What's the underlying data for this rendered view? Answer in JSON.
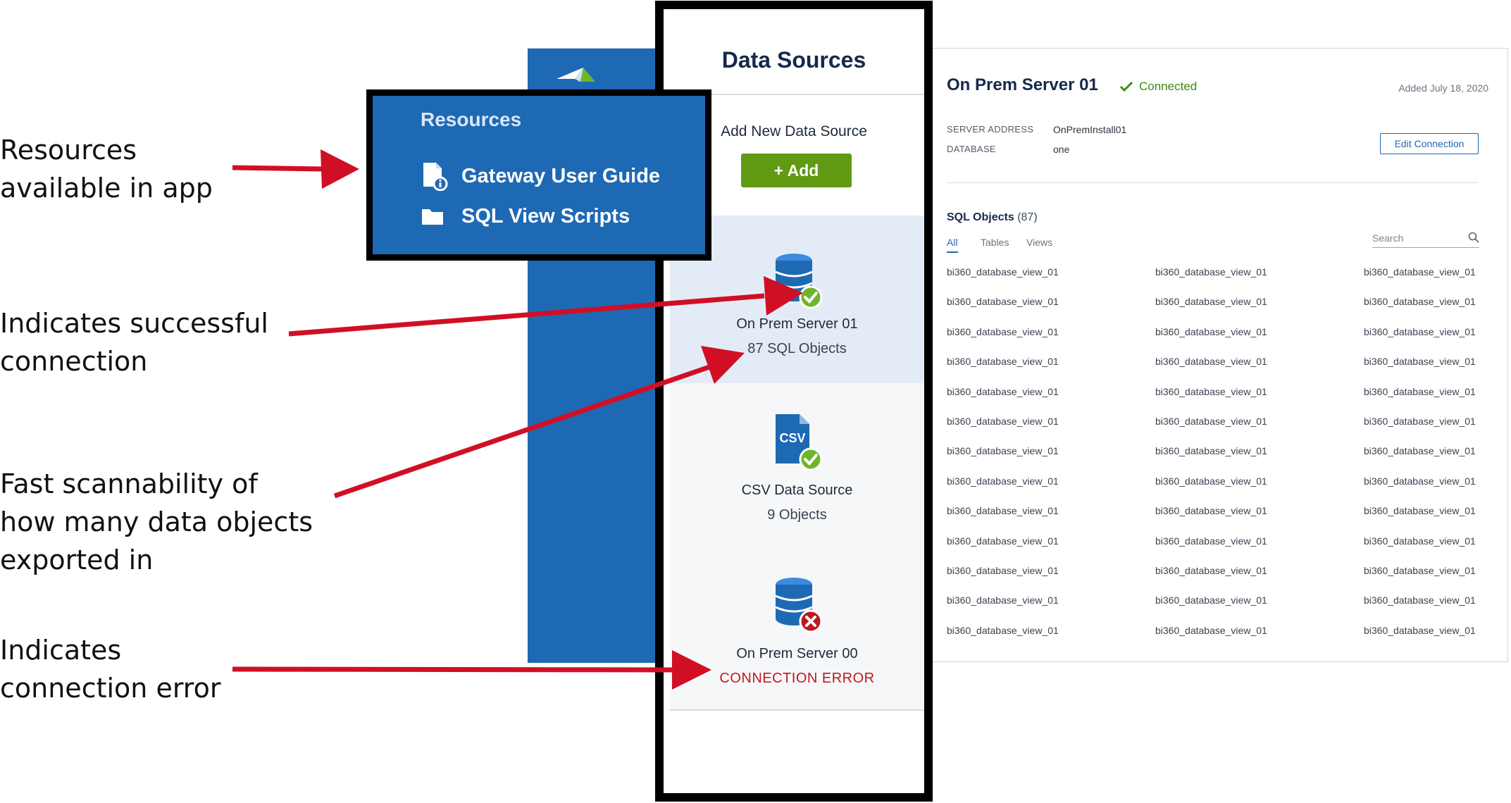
{
  "annotations": {
    "resources": [
      "Resources",
      "available in app"
    ],
    "success": [
      "Indicates successful",
      "connection"
    ],
    "scannability": [
      "Fast scannability of",
      "how many data objects",
      "exported in"
    ],
    "error": [
      "Indicates",
      "connection error"
    ]
  },
  "resources_panel": {
    "title": "Resources",
    "items": [
      {
        "label": "Gateway User Guide",
        "icon": "document-info-icon"
      },
      {
        "label": "SQL View Scripts",
        "icon": "folder-icon"
      }
    ]
  },
  "data_sources": {
    "title": "Data Sources",
    "add_label": "Add New Data Source",
    "add_button": "+ Add",
    "cards": [
      {
        "name": "On Prem Server 01",
        "meta": "87 SQL Objects",
        "icon": "database-check-icon",
        "status": "connected",
        "selected": true
      },
      {
        "name": "CSV Data Source",
        "meta": "9 Objects",
        "icon": "csv-file-check-icon",
        "status": "connected",
        "selected": false
      },
      {
        "name": "On Prem Server 00",
        "meta": "CONNECTION ERROR",
        "icon": "database-error-icon",
        "status": "error",
        "selected": false
      }
    ]
  },
  "detail": {
    "title": "On Prem Server 01",
    "status": "Connected",
    "added": "Added July 18, 2020",
    "server_address_label": "SERVER ADDRESS",
    "server_address_value": "OnPremInstall01",
    "database_label": "DATABASE",
    "database_value": "one",
    "edit_button": "Edit Connection",
    "sql_objects_label": "SQL Objects",
    "sql_objects_count": "(87)",
    "tabs": [
      "All",
      "Tables",
      "Views"
    ],
    "active_tab": "All",
    "search_placeholder": "Search",
    "object_name": "bi360_database_view_01",
    "visible_rows": 13,
    "visible_columns": 3
  },
  "colors": {
    "brand_blue": "#1e69b3",
    "add_green": "#5f9a12",
    "success_green": "#3d8a12",
    "error_red": "#c0181e",
    "arrow_red": "#d10f24",
    "selected_card_bg": "#e3ecf6"
  }
}
